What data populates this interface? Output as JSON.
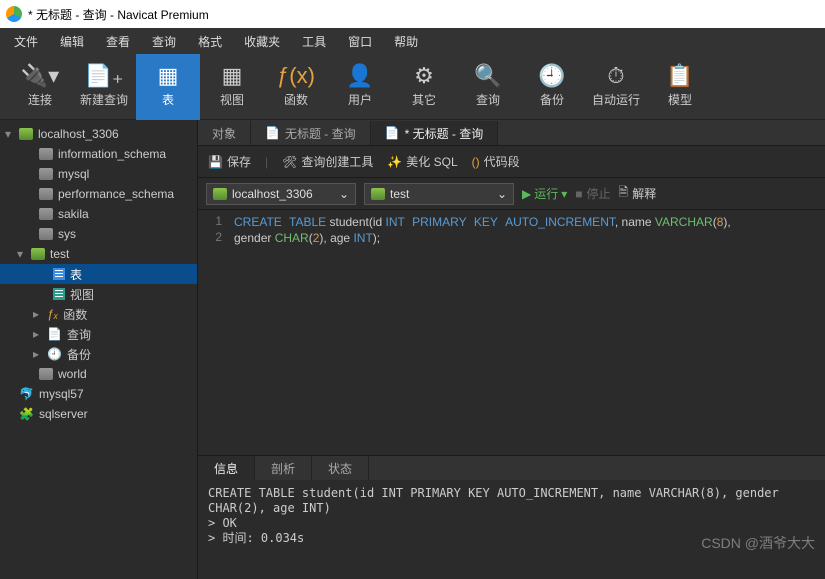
{
  "title": "* 无标题 - 查询 - Navicat Premium",
  "menu": [
    "文件",
    "编辑",
    "查看",
    "查询",
    "格式",
    "收藏夹",
    "工具",
    "窗口",
    "帮助"
  ],
  "ribbon": [
    {
      "icon": "🔌▾",
      "label": "连接"
    },
    {
      "icon": "📄₊",
      "label": "新建查询"
    },
    {
      "icon": "▦",
      "label": "表",
      "active": true
    },
    {
      "icon": "▦",
      "label": "视图"
    },
    {
      "icon": "ƒ(x)",
      "label": "函数"
    },
    {
      "icon": "👤",
      "label": "用户"
    },
    {
      "icon": "⚙",
      "label": "其它"
    },
    {
      "icon": "🔍",
      "label": "查询"
    },
    {
      "icon": "🕘",
      "label": "备份"
    },
    {
      "icon": "⏱",
      "label": "自动运行"
    },
    {
      "icon": "📋",
      "label": "模型"
    }
  ],
  "tree": {
    "root": "localhost_3306",
    "dbs": [
      "information_schema",
      "mysql",
      "performance_schema",
      "sakila",
      "sys"
    ],
    "openDb": "test",
    "children": [
      "表",
      "视图",
      "函数",
      "查询",
      "备份"
    ],
    "worldDb": "world",
    "conns": [
      "mysql57",
      "sqlserver"
    ]
  },
  "tabs": [
    {
      "label": "对象"
    },
    {
      "label": "无标题 - 查询",
      "dirty": false
    },
    {
      "label": "* 无标题 - 查询",
      "dirty": true,
      "active": true
    }
  ],
  "toolbar": {
    "save": "保存",
    "builder": "查询创建工具",
    "beautify": "美化 SQL",
    "snippet": "代码段"
  },
  "selectors": {
    "conn": "localhost_3306",
    "db": "test",
    "run": "运行",
    "stop": "停止",
    "explain": "解释"
  },
  "code": {
    "l1a": "CREATE",
    "l1b": "TABLE",
    "l1c": " student(id ",
    "l1d": "INT",
    "l1e": "PRIMARY",
    "l1f": "KEY",
    "l1g": "AUTO_INCREMENT",
    "l1h": ", name ",
    "l1i": "VARCHAR",
    "l1j": "(",
    "l1k": "8",
    "l1l": "),",
    "l2a": "gender ",
    "l2b": "CHAR",
    "l2c": "(",
    "l2d": "2",
    "l2e": "), age ",
    "l2f": "INT",
    "l2g": ");",
    "g1": "1",
    "g2": "2"
  },
  "panel": {
    "tabs": [
      "信息",
      "剖析",
      "状态"
    ],
    "out": "CREATE TABLE student(id INT PRIMARY KEY AUTO_INCREMENT, name VARCHAR(8), gender CHAR(2), age INT)\n> OK\n> 时间: 0.034s"
  },
  "watermark": "CSDN @酒爷大大",
  "fx": "ƒₓ"
}
